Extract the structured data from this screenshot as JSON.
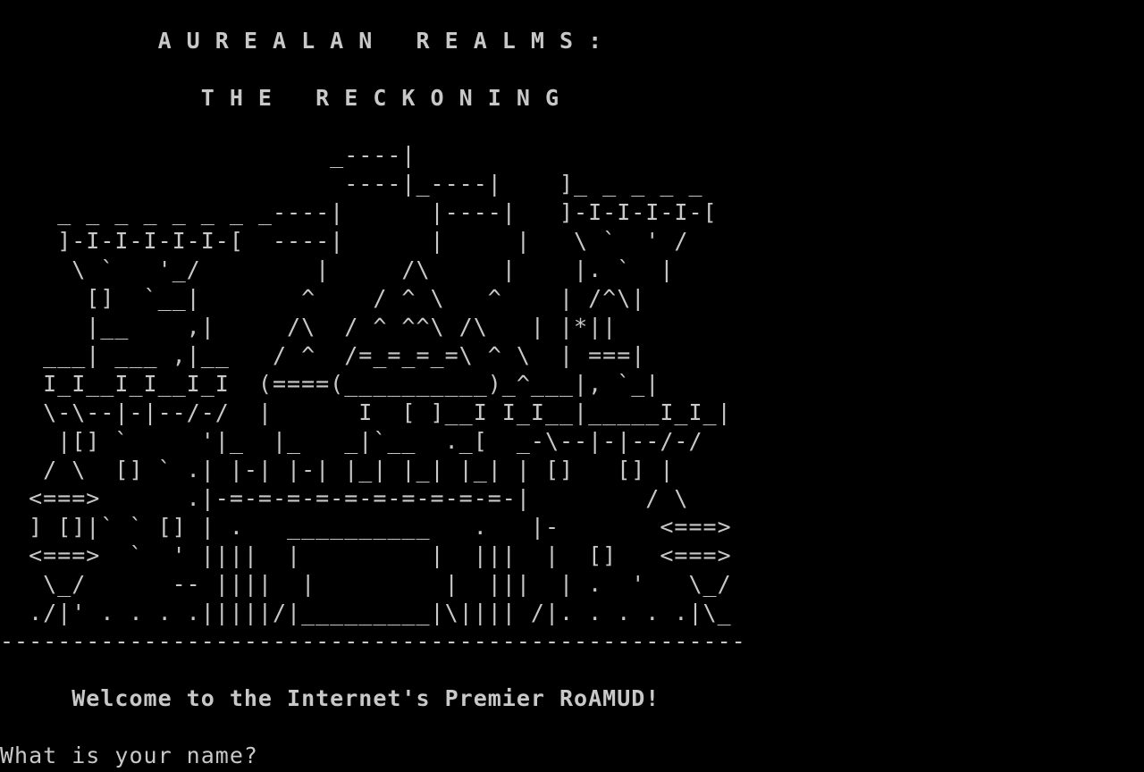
{
  "terminal": {
    "title_line_1": "           A U R E A L A N   R E A L M S :",
    "title_line_2": "              T H E   R E C K O N I N G",
    "art": [
      "                       _----|",
      "                        ----|_----|    ]_ _ _ _ _",
      "    _ _ _ _ _ _ _ _----|      |----|   ]-I-I-I-I-[",
      "    ]-I-I-I-I-I-[  ----|      |     |   \\ `  ' /",
      "     \\ `   '_/        |     /\\     |    |. `  |",
      "      []  `__|       ^    / ^ \\   ^    | /^\\|",
      "      |__    ,|     /\\  / ^ ^^\\ /\\   | |*||",
      "   ___| ___ ,|__   / ^  /=_=_=_=\\ ^ \\  | ===|",
      "   I_I__I_I__I_I  (====(__________)_^___|, `_|",
      "   \\-\\--|-|--/-/  |      I  [ ]__I I_I__|_____I_I_|",
      "    |[] `     '|_  |_   _|`__  ._[  _-\\--|-|--/-/",
      "   / \\  [] ` .| |-| |-| |_| |_| |_| | []   [] |",
      "  <===>      .|-=-=-=-=-=-=-=-=-=-=-|        / \\",
      "  ] []|` ` [] | .   __________   .   |-       <===>",
      "  <===>  `  ' ||||  |         |  |||  |  []   <===>",
      "   \\_/      -- ||||  |         |  |||  | .  '   \\_/",
      "  ./|' . . . .|||||/|_________|\\|||| /|. . . . .|\\_"
    ],
    "separator": "----------------------------------------------------",
    "welcome": "     Welcome to the Internet's Premier RoAMUD!",
    "prompt": "What is your name?"
  }
}
